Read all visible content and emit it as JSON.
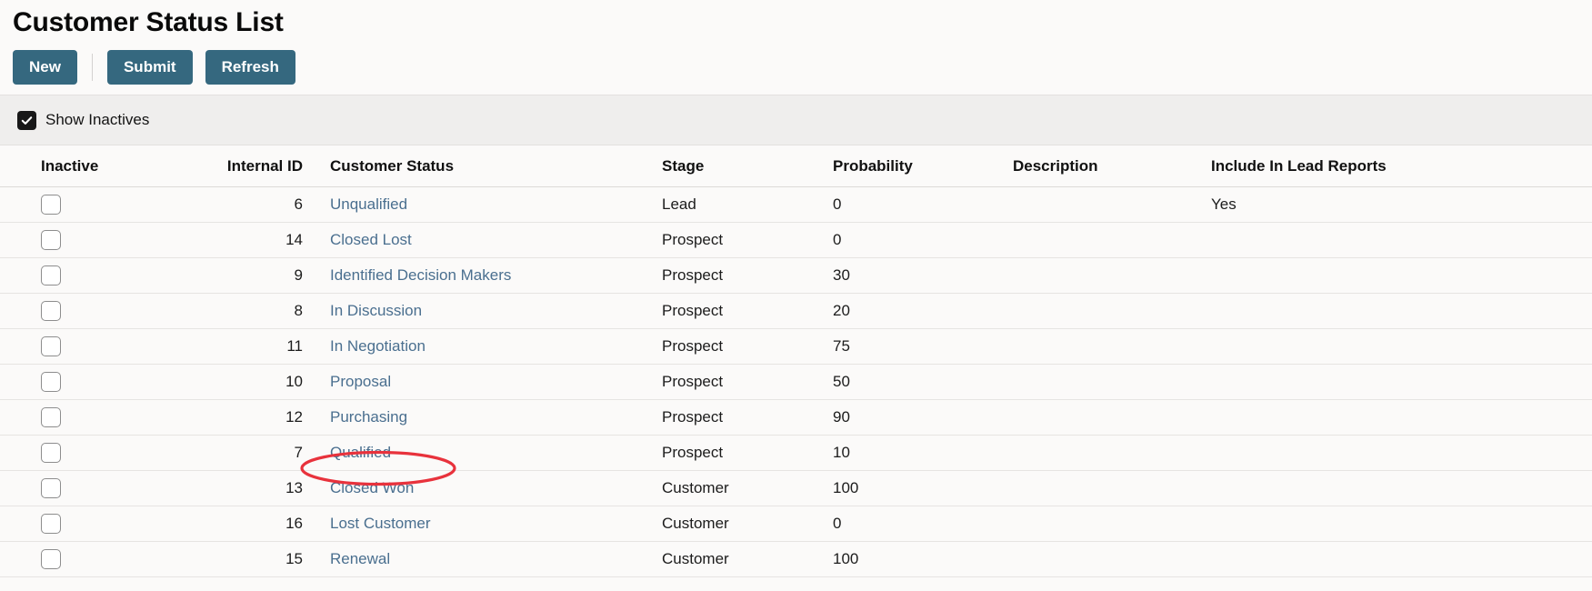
{
  "header": {
    "title": "Customer Status List"
  },
  "toolbar": {
    "new_label": "New",
    "submit_label": "Submit",
    "refresh_label": "Refresh"
  },
  "filter": {
    "show_inactives_label": "Show Inactives",
    "show_inactives_checked": true
  },
  "table": {
    "columns": [
      "Inactive",
      "Internal ID",
      "Customer Status",
      "Stage",
      "Probability",
      "Description",
      "Include In Lead Reports"
    ],
    "rows": [
      {
        "inactive": false,
        "internal_id": "6",
        "customer_status": "Unqualified",
        "stage": "Lead",
        "probability": "0",
        "description": "",
        "include_in_lead_reports": "Yes"
      },
      {
        "inactive": false,
        "internal_id": "14",
        "customer_status": "Closed Lost",
        "stage": "Prospect",
        "probability": "0",
        "description": "",
        "include_in_lead_reports": ""
      },
      {
        "inactive": false,
        "internal_id": "9",
        "customer_status": "Identified Decision Makers",
        "stage": "Prospect",
        "probability": "30",
        "description": "",
        "include_in_lead_reports": ""
      },
      {
        "inactive": false,
        "internal_id": "8",
        "customer_status": "In Discussion",
        "stage": "Prospect",
        "probability": "20",
        "description": "",
        "include_in_lead_reports": ""
      },
      {
        "inactive": false,
        "internal_id": "11",
        "customer_status": "In Negotiation",
        "stage": "Prospect",
        "probability": "75",
        "description": "",
        "include_in_lead_reports": ""
      },
      {
        "inactive": false,
        "internal_id": "10",
        "customer_status": "Proposal",
        "stage": "Prospect",
        "probability": "50",
        "description": "",
        "include_in_lead_reports": ""
      },
      {
        "inactive": false,
        "internal_id": "12",
        "customer_status": "Purchasing",
        "stage": "Prospect",
        "probability": "90",
        "description": "",
        "include_in_lead_reports": ""
      },
      {
        "inactive": false,
        "internal_id": "7",
        "customer_status": "Qualified",
        "stage": "Prospect",
        "probability": "10",
        "description": "",
        "include_in_lead_reports": ""
      },
      {
        "inactive": false,
        "internal_id": "13",
        "customer_status": "Closed Won",
        "stage": "Customer",
        "probability": "100",
        "description": "",
        "include_in_lead_reports": ""
      },
      {
        "inactive": false,
        "internal_id": "16",
        "customer_status": "Lost Customer",
        "stage": "Customer",
        "probability": "0",
        "description": "",
        "include_in_lead_reports": ""
      },
      {
        "inactive": false,
        "internal_id": "15",
        "customer_status": "Renewal",
        "stage": "Customer",
        "probability": "100",
        "description": "",
        "include_in_lead_reports": ""
      }
    ]
  },
  "annotation": {
    "type": "ellipse-highlight",
    "target_row_internal_id": "7",
    "target_row_customer_status": "Qualified",
    "color": "#e8323c"
  },
  "colors": {
    "button_background": "#35687f",
    "button_text": "#ffffff",
    "page_background": "#fbfaf9",
    "filterbar_background": "#efeeed",
    "link": "#4a6f8f",
    "annotation_red": "#e8323c"
  }
}
